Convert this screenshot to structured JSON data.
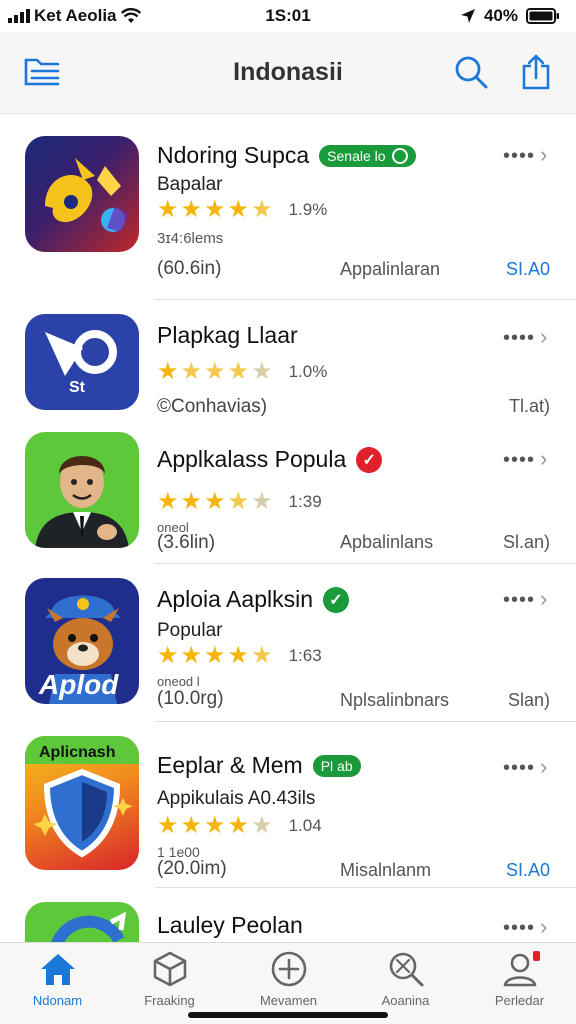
{
  "status_bar": {
    "carrier": "Ket Aeolia",
    "time": "1S:01",
    "battery": "40%"
  },
  "nav": {
    "title": "Indonasii",
    "left_icon": "list-icon",
    "search_icon": "search-icon",
    "share_icon": "share-icon"
  },
  "apps": [
    {
      "title": "Ndoring Supca",
      "badge_text": "Senale lo",
      "subtitle": "Bapalar",
      "rating_text": "1.9%",
      "rating": 4.5,
      "small": "3ɪ4:6lems",
      "size": "(60.6in)",
      "category": "Appalinlaran",
      "action": "SI.A0",
      "action_color": "#1a78d8"
    },
    {
      "title": "Plapkag Llaar",
      "subtitle": "",
      "rating_text": "1.0%",
      "rating": 3,
      "small": "",
      "size": "©Conhavias)",
      "category": "",
      "action": "Tl.at)",
      "action_color": "#555555"
    },
    {
      "title": "Applkalass Popula",
      "subtitle": "",
      "rating_text": "1:39",
      "rating": 3.5,
      "small": "oneol",
      "size": "(3.6lin)",
      "category": "Apbalinlans",
      "action": "Sl.an)",
      "action_color": "#555555"
    },
    {
      "title": "Aploia Aaplksin",
      "subtitle": "Popular",
      "rating_text": "1:63",
      "rating": 4.5,
      "small": "oneod l",
      "size": "(10.0rg)",
      "category": "Nplsalinbnars",
      "action": "Slan)",
      "action_color": "#555555"
    },
    {
      "title": "Eeplar & Mem",
      "badge_text": "Pl ab",
      "subtitle": "Appikulais A0.43ils",
      "rating_text": "1.04",
      "rating": 4,
      "small": "1 1e00",
      "size": "(20.0im)",
      "category": "Misalnlanm",
      "action": "SI.A0",
      "action_color": "#1a78d8"
    },
    {
      "title": "Lauley Peolan"
    }
  ],
  "tabs": [
    {
      "label": "Ndonam",
      "icon": "home-icon"
    },
    {
      "label": "Fraaking",
      "icon": "cube-icon"
    },
    {
      "label": "Mevamen",
      "icon": "plus-circle-icon"
    },
    {
      "label": "Aoanina",
      "icon": "search-tools-icon"
    },
    {
      "label": "Perledar",
      "icon": "person-icon"
    }
  ],
  "colors": {
    "accent": "#1a78d8",
    "badge_green": "#1a9a3a",
    "badge_red": "#e0202a",
    "star": "#f5b50a"
  }
}
